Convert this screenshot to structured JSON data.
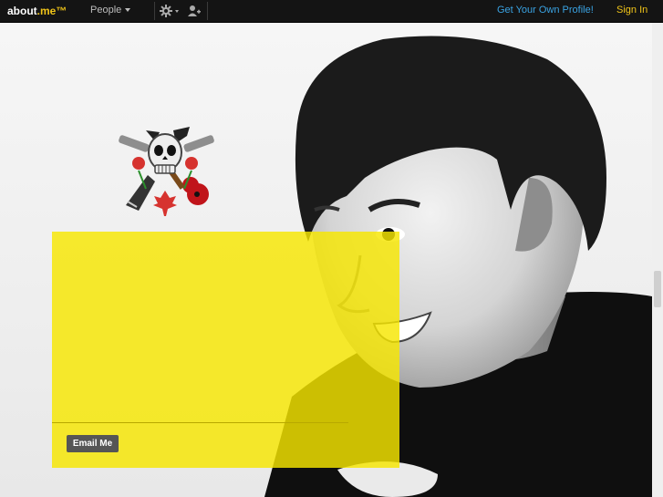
{
  "topbar": {
    "logo_text": "about",
    "logo_dot": ".me",
    "logo_tm": "™",
    "people_label": "People",
    "get_profile_label": "Get Your Own Profile!",
    "sign_in_label": "Sign In"
  },
  "card": {
    "email_button_label": "Email Me"
  },
  "colors": {
    "card_yellow": "#f6e600",
    "topbar": "#141414",
    "link_blue": "#3aa3e3",
    "accent_yellow": "#f0c419"
  },
  "icons": {
    "settings": "gear-icon",
    "add_person": "add-person-icon",
    "emblem": "skull-guitars-emblem"
  }
}
